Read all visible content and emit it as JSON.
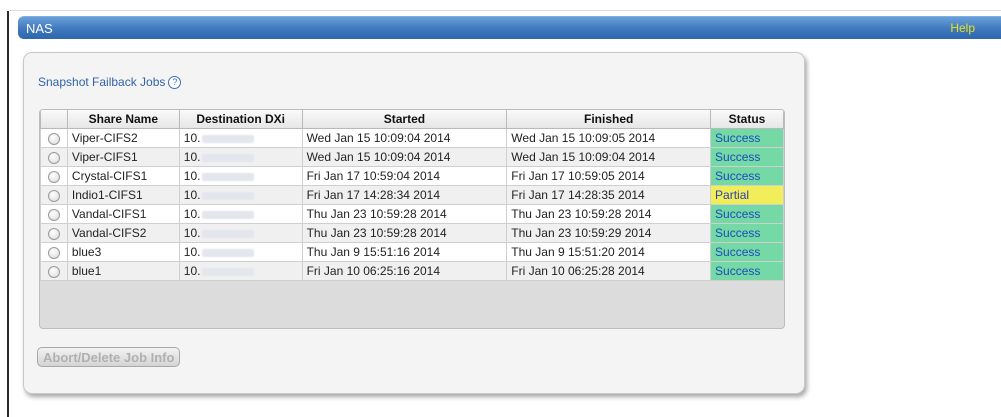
{
  "header": {
    "title": "NAS",
    "help_label": "Help"
  },
  "section": {
    "title": "Snapshot Failback Jobs",
    "help_icon": "?"
  },
  "table": {
    "columns": [
      "Share Name",
      "Destination DXi",
      "Started",
      "Finished",
      "Status"
    ],
    "rows": [
      {
        "share": "Viper-CIFS2",
        "dest": "10.",
        "started": "Wed Jan 15 10:09:04 2014",
        "finished": "Wed Jan 15 10:09:05 2014",
        "status": "Success"
      },
      {
        "share": "Viper-CIFS1",
        "dest": "10.",
        "started": "Wed Jan 15 10:09:04 2014",
        "finished": "Wed Jan 15 10:09:04 2014",
        "status": "Success"
      },
      {
        "share": "Crystal-CIFS1",
        "dest": "10.",
        "started": "Fri Jan 17 10:59:04 2014",
        "finished": "Fri Jan 17 10:59:05 2014",
        "status": "Success"
      },
      {
        "share": "Indio1-CIFS1",
        "dest": "10.",
        "started": "Fri Jan 17 14:28:34 2014",
        "finished": "Fri Jan 17 14:28:35 2014",
        "status": "Partial"
      },
      {
        "share": "Vandal-CIFS1",
        "dest": "10.",
        "started": "Thu Jan 23 10:59:28 2014",
        "finished": "Thu Jan 23 10:59:28 2014",
        "status": "Success"
      },
      {
        "share": "Vandal-CIFS2",
        "dest": "10.",
        "started": "Thu Jan 23 10:59:28 2014",
        "finished": "Thu Jan 23 10:59:29 2014",
        "status": "Success"
      },
      {
        "share": "blue3",
        "dest": "10.",
        "started": "Thu Jan 9 15:51:16 2014",
        "finished": "Thu Jan 9 15:51:20 2014",
        "status": "Success"
      },
      {
        "share": "blue1",
        "dest": "10.",
        "started": "Fri Jan 10 06:25:16 2014",
        "finished": "Fri Jan 10 06:25:28 2014",
        "status": "Success"
      }
    ]
  },
  "actions": {
    "abort_label": "Abort/Delete Job Info"
  },
  "colors": {
    "titlebar": "#3f78bd",
    "help": "#e8e21c",
    "success_bg": "#74d9a4",
    "partial_bg": "#f2ee5b",
    "link": "#3162a8"
  }
}
